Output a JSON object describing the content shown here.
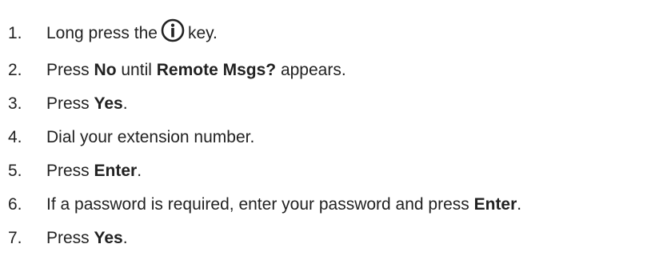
{
  "steps": [
    {
      "number": "1.",
      "parts": {
        "a": "Long press the",
        "icon": "info-icon",
        "b": "key."
      }
    },
    {
      "number": "2.",
      "parts": {
        "a": "Press",
        "b1": "No",
        "c": "until",
        "b2": "Remote Msgs?",
        "d": "appears."
      }
    },
    {
      "number": "3.",
      "parts": {
        "a": "Press",
        "b1": "Yes",
        "c": "."
      }
    },
    {
      "number": "4.",
      "parts": {
        "a": "Dial your extension number."
      }
    },
    {
      "number": "5.",
      "parts": {
        "a": "Press",
        "b1": "Enter",
        "c": "."
      }
    },
    {
      "number": "6.",
      "parts": {
        "a": "If a password is required, enter your password and press",
        "b1": "Enter",
        "c": "."
      }
    },
    {
      "number": "7.",
      "parts": {
        "a": "Press",
        "b1": "Yes",
        "c": "."
      }
    }
  ],
  "colors": {
    "text": "#222222",
    "background": "#ffffff"
  }
}
